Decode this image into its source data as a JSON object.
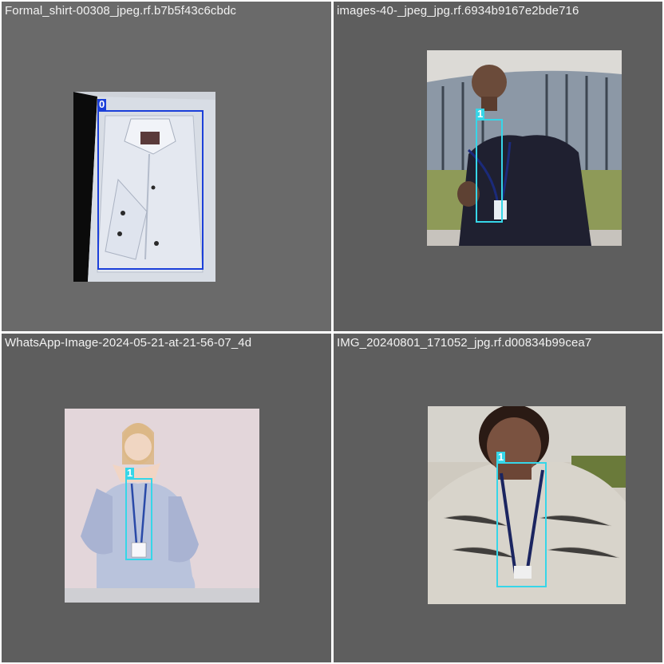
{
  "tiles": [
    {
      "title": "Formal_shirt-00308_jpeg.rf.b7b5f43c6cbdc",
      "box_label": "0",
      "box_color": "#1b3fd9"
    },
    {
      "title": "images-40-_jpeg_jpg.rf.6934b9167e2bde716",
      "box_label": "1",
      "box_color": "#36d6e8"
    },
    {
      "title": "WhatsApp-Image-2024-05-21-at-21-56-07_4d",
      "box_label": "1",
      "box_color": "#36d6e8"
    },
    {
      "title": "IMG_20240801_171052_jpg.rf.d00834b99cea7",
      "box_label": "1",
      "box_color": "#36d6e8"
    }
  ],
  "colors": {
    "tile_bg": "#5e5e5e",
    "separator": "#ffffff",
    "class0": "#1b3fd9",
    "class1": "#36d6e8"
  }
}
